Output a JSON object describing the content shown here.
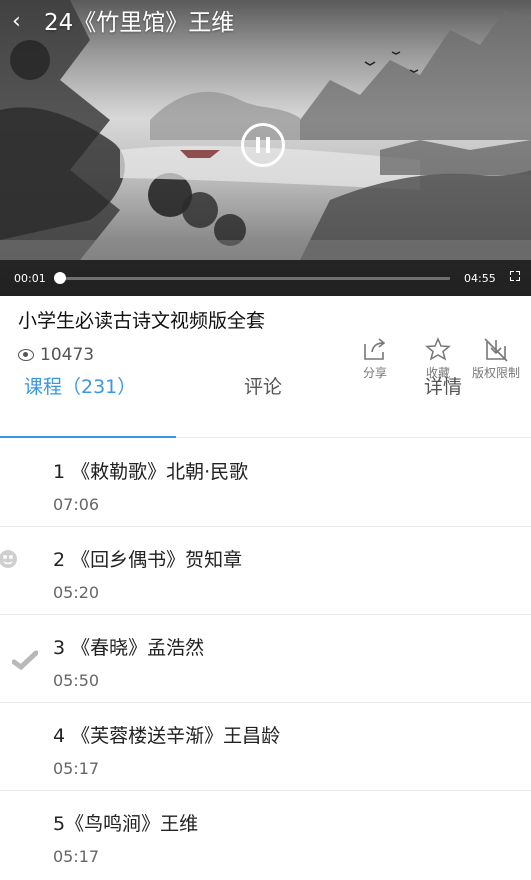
{
  "video": {
    "back_icon": "chevron-left-icon",
    "title": "24《竹里馆》王维",
    "current_time": "00:01",
    "total_time": "04:55",
    "progress": 0.0,
    "state_icon": "pause-icon",
    "fullscreen_icon": "fullscreen-icon"
  },
  "course": {
    "title": "小学生必读古诗文视频版全套",
    "views": "10473"
  },
  "actions": [
    {
      "label": "分享",
      "icon": "share-icon"
    },
    {
      "label": "收藏",
      "icon": "star-icon"
    },
    {
      "label": "版权限制",
      "icon": "download-restricted-icon"
    }
  ],
  "tabs": [
    {
      "label": "课程（231）",
      "active": true
    },
    {
      "label": "评论",
      "active": false
    },
    {
      "label": "详情",
      "active": false
    }
  ],
  "lessons": [
    {
      "title": "1 《敕勒歌》北朝·民歌",
      "duration": "07:06",
      "status": "none"
    },
    {
      "title": "2 《回乡偶书》贺知章",
      "duration": "05:20",
      "status": "playing-avatar"
    },
    {
      "title": "3 《春晓》孟浩然",
      "duration": "05:50",
      "status": "watched-check"
    },
    {
      "title": "4 《芙蓉楼送辛渐》王昌龄",
      "duration": "05:17",
      "status": "none"
    },
    {
      "title": "5《鸟鸣涧》王维",
      "duration": "05:17",
      "status": "none"
    }
  ],
  "colors": {
    "accent": "#3a96e6",
    "text": "#222222",
    "muted": "#666666"
  }
}
